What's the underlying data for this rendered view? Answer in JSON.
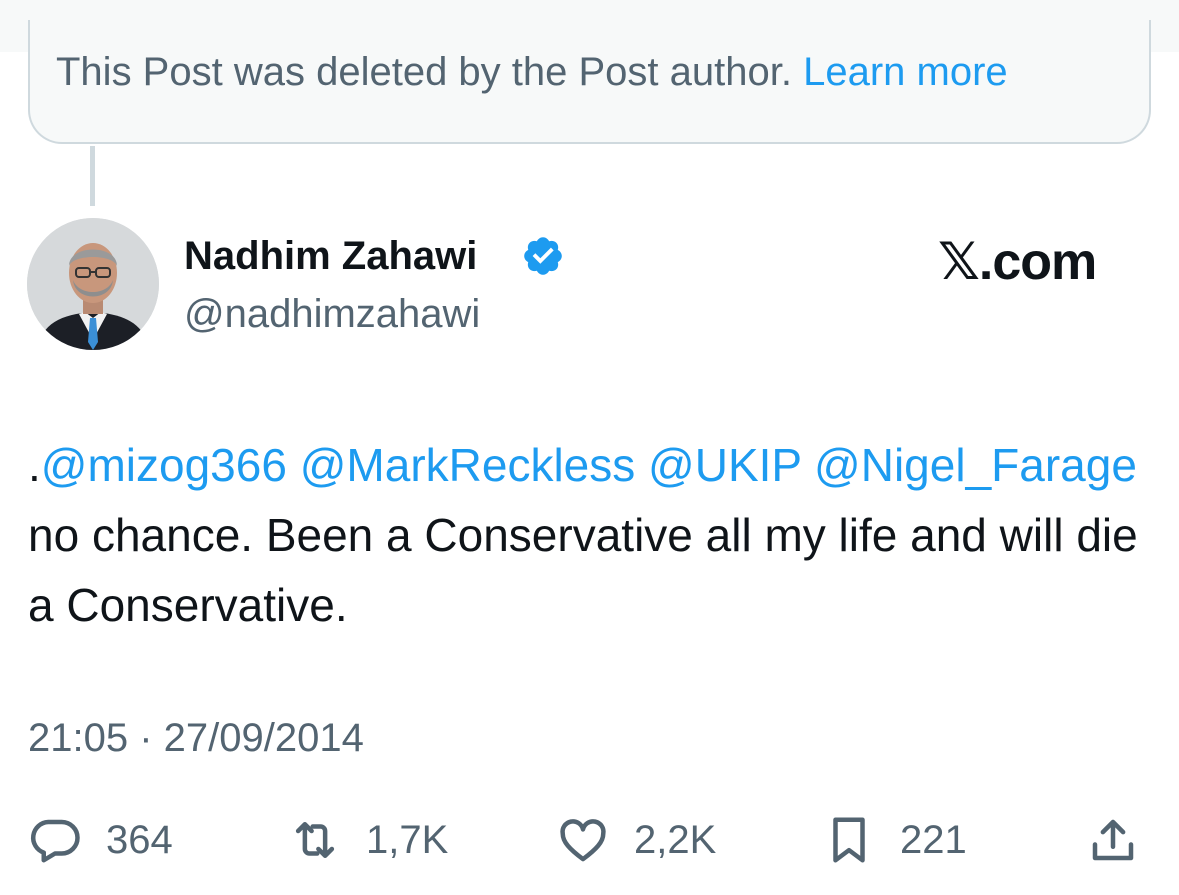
{
  "deleted_notice": {
    "text": "This Post was deleted by the Post author.",
    "link": "Learn more"
  },
  "post": {
    "author_name": "Nadhim Zahawi",
    "handle": "@nadhimzahawi",
    "verified": true,
    "watermark": "𝕏.com",
    "text": {
      "prefix": ".",
      "mention1": "@mizog366",
      "mention2": "@MarkReckless",
      "mention3": "@UKIP",
      "mention4": "@Nigel_Farage",
      "body": " no chance. Been a Conservative all my life and will die a Conservative."
    },
    "timestamp": "21:05 · 27/09/2014"
  },
  "actions": {
    "replies": "364",
    "reposts": "1,7K",
    "likes": "2,2K",
    "bookmarks": "221"
  },
  "icons": {
    "verified": "verified-badge-icon",
    "reply": "speech-bubble-icon",
    "repost": "repost-arrows-icon",
    "like": "heart-icon",
    "bookmark": "bookmark-icon",
    "share": "share-upload-icon"
  },
  "colors": {
    "accent": "#1d9bf0",
    "secondary_text": "#536471",
    "primary_text": "#0f1419",
    "border": "#cfd9de"
  }
}
